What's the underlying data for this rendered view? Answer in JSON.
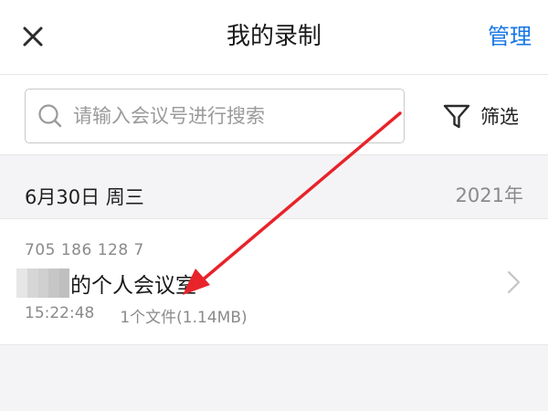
{
  "header": {
    "title": "我的录制",
    "manage_label": "管理"
  },
  "search": {
    "placeholder": "请输入会议号进行搜索",
    "value": ""
  },
  "filter": {
    "label": "筛选"
  },
  "recordings": {
    "group_date": "6月30日 周三",
    "group_year": "2021年",
    "items": [
      {
        "meeting_id": "705 186 128 7",
        "name": "的个人会议室",
        "time": "15:22:48",
        "files": "1个文件(1.14MB)"
      }
    ]
  },
  "colors": {
    "accent": "#1677e6",
    "annotation_arrow": "#e8232a"
  },
  "icons": {
    "close": "close-icon",
    "search": "search-icon",
    "filter": "filter-funnel-icon",
    "chevron": "chevron-right-icon"
  }
}
